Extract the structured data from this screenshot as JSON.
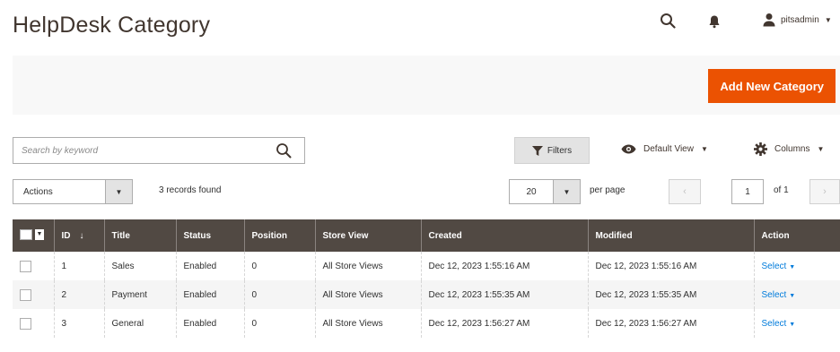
{
  "header": {
    "title": "HelpDesk Category",
    "user_name": "pitsadmin",
    "icons": {
      "search": "search-icon",
      "notifications": "bell-icon",
      "user": "user-icon"
    }
  },
  "actions_bar": {
    "add_button_label": "Add New Category",
    "accent_color": "#eb5202"
  },
  "toolbar": {
    "search_placeholder": "Search by keyword",
    "filters_label": "Filters",
    "view_label": "Default View",
    "columns_label": "Columns",
    "actions_label": "Actions",
    "records_text": "3 records found",
    "per_page_value": "20",
    "per_page_label": "per page",
    "page_current": "1",
    "page_of": "of 1"
  },
  "table": {
    "columns": [
      "ID",
      "Title",
      "Status",
      "Position",
      "Store View",
      "Created",
      "Modified",
      "Action"
    ],
    "rows": [
      {
        "id": "1",
        "title": "Sales",
        "status": "Enabled",
        "position": "0",
        "store_view": "All Store Views",
        "created": "Dec 12, 2023 1:55:16 AM",
        "modified": "Dec 12, 2023 1:55:16 AM",
        "action": "Select"
      },
      {
        "id": "2",
        "title": "Payment",
        "status": "Enabled",
        "position": "0",
        "store_view": "All Store Views",
        "created": "Dec 12, 2023 1:55:35 AM",
        "modified": "Dec 12, 2023 1:55:35 AM",
        "action": "Select"
      },
      {
        "id": "3",
        "title": "General",
        "status": "Enabled",
        "position": "0",
        "store_view": "All Store Views",
        "created": "Dec 12, 2023 1:56:27 AM",
        "modified": "Dec 12, 2023 1:56:27 AM",
        "action": "Select"
      }
    ]
  }
}
